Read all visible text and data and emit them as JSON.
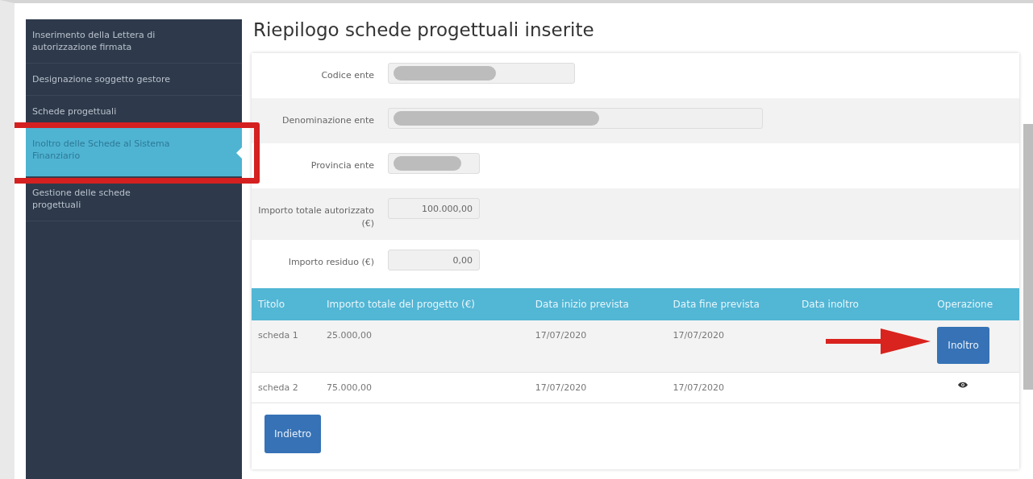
{
  "sidebar": {
    "items": [
      {
        "label": "Inserimento della Lettera di autorizzazione firmata",
        "selected": false,
        "annotated": false
      },
      {
        "label": "Designazione soggetto gestore",
        "selected": false,
        "annotated": false
      },
      {
        "label": "Schede progettuali",
        "selected": false,
        "annotated": false
      },
      {
        "label": "Inoltro delle Schede al Sistema Finanziario",
        "selected": true,
        "annotated": true
      },
      {
        "label": "Gestione delle schede progettuali",
        "selected": false,
        "annotated": false
      }
    ]
  },
  "title": "Riepilogo schede progettuali inserite",
  "form": [
    {
      "label": "Codice ente",
      "redacted": true
    },
    {
      "label": "Denominazione ente",
      "redacted": true
    },
    {
      "label": "Provincia ente",
      "redacted": true
    },
    {
      "label": "Importo totale autorizzato (€)",
      "value": "100.000,00",
      "redacted": false
    },
    {
      "label": "Importo residuo (€)",
      "value": "0,00",
      "redacted": false
    }
  ],
  "table": {
    "columns": [
      "Titolo",
      "Importo totale del progetto (€)",
      "Data inizio prevista",
      "Data fine prevista",
      "Data inoltro",
      "Operazione"
    ],
    "rows": [
      {
        "cells": [
          "scheda 1",
          "25.000,00",
          "17/07/2020",
          "17/07/2020"
        ],
        "operation": {
          "kind": "button",
          "label": "Inoltro"
        },
        "arrow_annotation": true
      },
      {
        "cells": [
          "scheda 2",
          "75.000,00",
          "17/07/2020",
          "17/07/2020"
        ],
        "operation": {
          "kind": "view"
        },
        "arrow_annotation": false
      }
    ]
  },
  "back_button": "Indietro"
}
